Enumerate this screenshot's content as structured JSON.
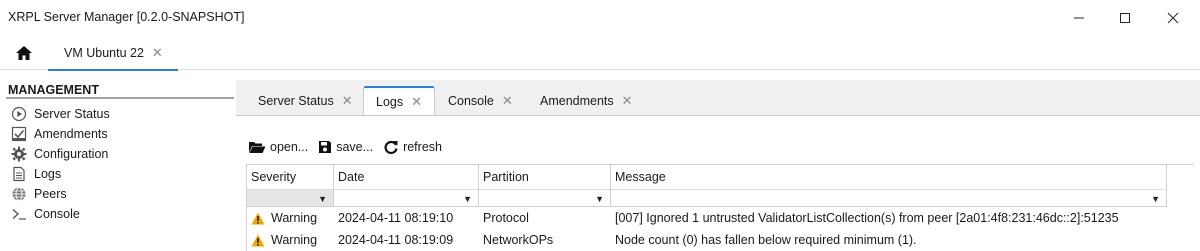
{
  "window": {
    "title": "XRPL Server Manager [0.2.0-SNAPSHOT]",
    "controls": {
      "minimize_icon": "minimize-icon",
      "maximize_icon": "maximize-icon",
      "close_icon": "close-icon"
    }
  },
  "top_tabs": [
    {
      "icon": "home-icon"
    },
    {
      "label": "VM Ubuntu 22",
      "closable": true,
      "active": true
    }
  ],
  "sidebar": {
    "heading": "MANAGEMENT",
    "items": [
      {
        "label": "Server Status",
        "icon": "play-circle-icon"
      },
      {
        "label": "Amendments",
        "icon": "checkbox-icon"
      },
      {
        "label": "Configuration",
        "icon": "gear-icon"
      },
      {
        "label": "Logs",
        "icon": "document-icon"
      },
      {
        "label": "Peers",
        "icon": "globe-icon"
      },
      {
        "label": "Console",
        "icon": "terminal-icon"
      }
    ]
  },
  "content_tabs": [
    {
      "label": "Server Status",
      "active": false
    },
    {
      "label": "Logs",
      "active": true
    },
    {
      "label": "Console",
      "active": false
    },
    {
      "label": "Amendments",
      "active": false
    }
  ],
  "toolbar": {
    "open_label": "open...",
    "save_label": "save...",
    "refresh_label": "refresh"
  },
  "table": {
    "columns": [
      "Severity",
      "Date",
      "Partition",
      "Message"
    ],
    "rows": [
      {
        "severity": "Warning",
        "date": "2024-04-11 08:19:10",
        "partition": "Protocol",
        "message": "[007] Ignored 1 untrusted ValidatorListCollection(s) from peer [2a01:4f8:231:46dc::2]:51235"
      },
      {
        "severity": "Warning",
        "date": "2024-04-11 08:19:09",
        "partition": "NetworkOPs",
        "message": "Node count (0) has fallen below required minimum (1)."
      }
    ]
  },
  "colors": {
    "accent": "#2a7fd4",
    "warning": "#f0a800"
  }
}
